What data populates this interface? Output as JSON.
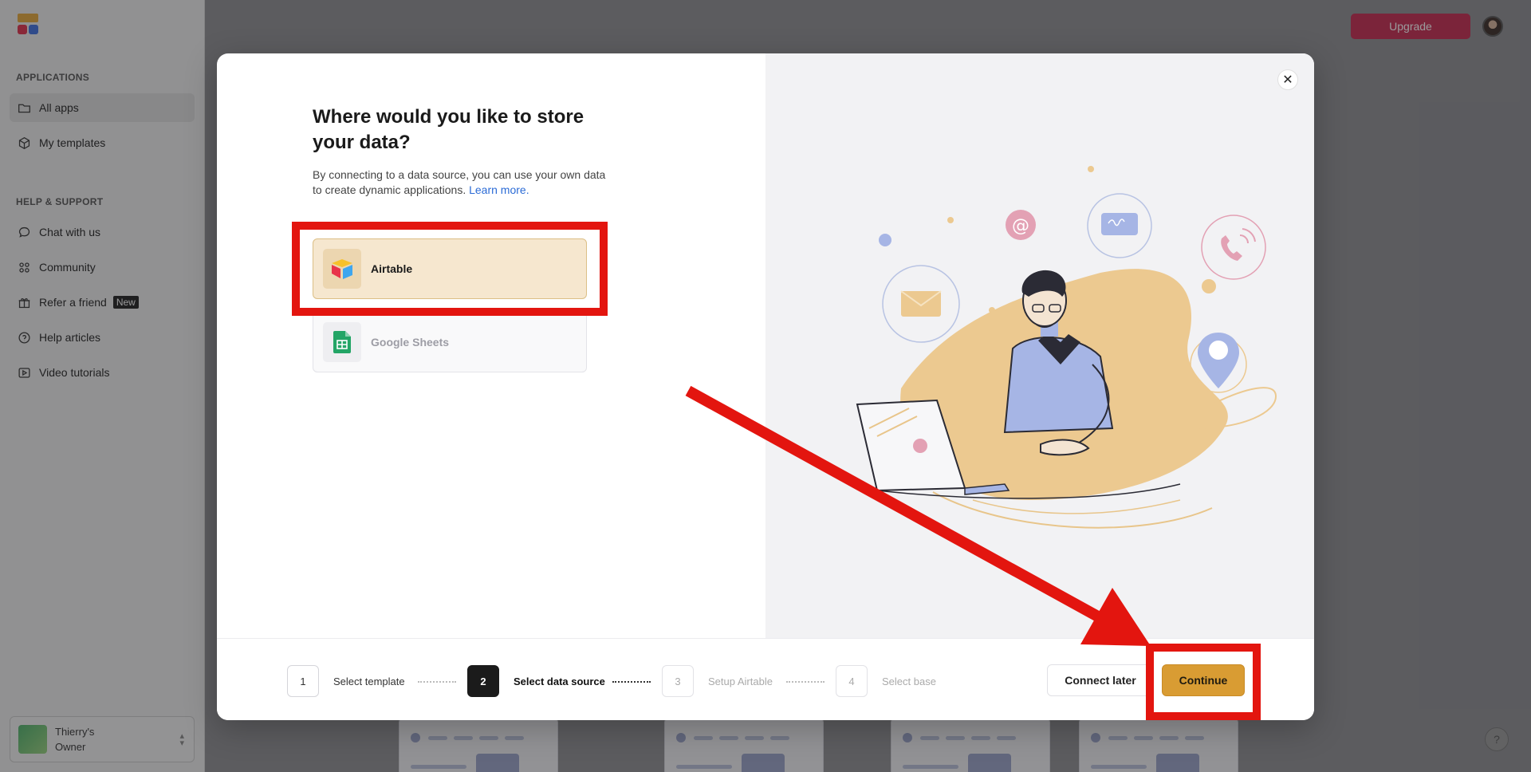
{
  "sidebar": {
    "sections": [
      {
        "title": "APPLICATIONS"
      },
      {
        "title": "HELP & SUPPORT"
      }
    ],
    "items": [
      {
        "label": "All apps",
        "icon": "folder-icon"
      },
      {
        "label": "My templates",
        "icon": "box-icon"
      },
      {
        "label": "Chat with us",
        "icon": "chat-bubble-icon"
      },
      {
        "label": "Community",
        "icon": "community-icon"
      },
      {
        "label": "Refer a friend",
        "icon": "gift-icon",
        "badge": "New"
      },
      {
        "label": "Help articles",
        "icon": "question-circle-icon"
      },
      {
        "label": "Video tutorials",
        "icon": "play-icon"
      }
    ],
    "profile": {
      "name": "Thierry's",
      "role": "Owner"
    }
  },
  "header": {
    "upgrade_label": "Upgrade"
  },
  "modal": {
    "title": "Where would you like to store your data?",
    "description": "By connecting to a data source, you can use your own data to create dynamic applications.",
    "learn_more": "Learn more.",
    "options": [
      {
        "label": "Airtable",
        "state": "selected"
      },
      {
        "label": "Google Sheets",
        "state": "disabled"
      }
    ],
    "steps": [
      {
        "number": "1",
        "label": "Select template",
        "state": "done"
      },
      {
        "number": "2",
        "label": "Select data source",
        "state": "active"
      },
      {
        "number": "3",
        "label": "Setup Airtable",
        "state": "future"
      },
      {
        "number": "4",
        "label": "Select base",
        "state": "future"
      }
    ],
    "connect_later_label": "Connect later",
    "continue_label": "Continue"
  },
  "colors": {
    "accent": "#d99c33",
    "upgrade": "#c6284f",
    "annotation": "#e3150f",
    "selected_option": "#f6e7cf"
  }
}
